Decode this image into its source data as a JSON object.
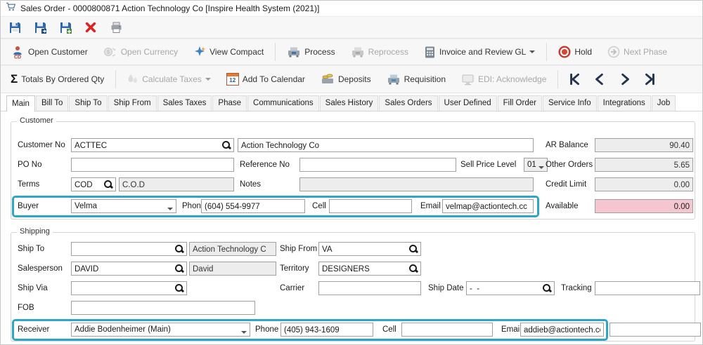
{
  "window": {
    "title": "Sales Order - 0000800871 Action Technology Co [Inspire Health System (2021)]"
  },
  "colors": {
    "highlight_border": "#2DA6C9",
    "available_bg": "#F5C6D0",
    "hold_red": "#D8453A",
    "accent_blue": "#2F66AD"
  },
  "toolbar_main": {
    "open_customer": "Open Customer",
    "open_customer_icon_text": "CD",
    "open_currency": "Open Currency",
    "view_compact": "View Compact",
    "process": "Process",
    "reprocess": "Reprocess",
    "invoice_review_gl": "Invoice and Review GL",
    "hold": "Hold",
    "next_phase": "Next Phase"
  },
  "toolbar_secondary": {
    "sigma_icon": "Σ",
    "totals_by_ordered_qty": "Totals By Ordered Qty",
    "calculate_taxes": "Calculate Taxes",
    "add_to_calendar": "Add To Calendar",
    "calendar_icon_text": "12",
    "deposits": "Deposits",
    "requisition": "Requisition",
    "edi_acknowledge": "EDI: Acknowledge"
  },
  "tabs": [
    "Main",
    "Bill To",
    "Ship To",
    "Ship From",
    "Sales Taxes",
    "Phase",
    "Communications",
    "Sales History",
    "Sales Orders",
    "User Defined",
    "Fill Order",
    "Service Info",
    "Integrations",
    "Job"
  ],
  "customer": {
    "legend": "Customer",
    "labels": {
      "customer_no": "Customer No",
      "po_no": "PO No",
      "reference_no": "Reference No",
      "sell_price_level": "Sell Price Level",
      "terms": "Terms",
      "notes": "Notes",
      "buyer": "Buyer",
      "phone": "Phone",
      "cell": "Cell",
      "email": "Email"
    },
    "values": {
      "customer_no": "ACTTEC",
      "customer_name": "Action Technology Co",
      "po_no": "",
      "reference_no": "",
      "sell_price_level": "01",
      "terms_code": "COD",
      "terms_desc": "C.O.D",
      "notes": "",
      "buyer": "Velma",
      "phone": "(604) 554-9977",
      "cell": "",
      "email": "velmap@actiontech.cc"
    }
  },
  "balances": {
    "labels": {
      "ar_balance": "AR Balance",
      "other_orders": "Other Orders",
      "credit_limit": "Credit Limit",
      "available": "Available"
    },
    "values": {
      "ar_balance": "90.40",
      "other_orders": "5.65",
      "credit_limit": "0.00",
      "available": "0.00"
    }
  },
  "shipping": {
    "legend": "Shipping",
    "labels": {
      "ship_to": "Ship To",
      "ship_from": "Ship From",
      "salesperson": "Salesperson",
      "territory": "Territory",
      "ship_via": "Ship Via",
      "carrier": "Carrier",
      "ship_date": "Ship Date",
      "tracking": "Tracking",
      "fob": "FOB",
      "receiver": "Receiver",
      "phone": "Phone",
      "cell": "Cell",
      "email": "Email"
    },
    "values": {
      "ship_to_code": "",
      "ship_to_name": "Action Technology C",
      "ship_from": "VA",
      "salesperson_code": "DAVID",
      "salesperson_name": "David",
      "territory": "DESIGNERS",
      "ship_via": "",
      "carrier": "",
      "ship_date": "-  -",
      "tracking": "",
      "fob": "",
      "receiver": "Addie Bodenheimer (Main)",
      "phone": "(405) 943-1609",
      "cell": "",
      "email": "addieb@actiontech.cc",
      "extra": ""
    }
  }
}
